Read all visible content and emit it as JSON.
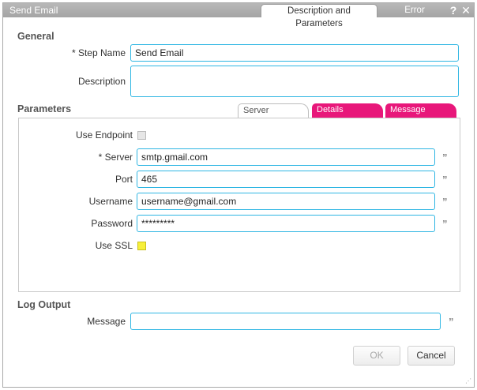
{
  "window": {
    "title": "Send Email",
    "tabs": [
      {
        "label": "Description and Parameters",
        "active": true
      },
      {
        "label": "Error Handling",
        "active": false
      }
    ],
    "help_icon": "?",
    "close_icon": "✕"
  },
  "general": {
    "section_label": "General",
    "step_name_label": "* Step Name",
    "step_name_value": "Send Email",
    "description_label": "Description",
    "description_value": ""
  },
  "parameters": {
    "section_label": "Parameters",
    "tabs": [
      {
        "label": "Server",
        "active": true,
        "color": "#ffffff"
      },
      {
        "label": "Details",
        "active": false,
        "color": "#e8177a"
      },
      {
        "label": "Message",
        "active": false,
        "color": "#e8177a"
      }
    ],
    "use_endpoint_label": "Use Endpoint",
    "use_endpoint_checked": false,
    "server_label": "* Server",
    "server_value": "smtp.gmail.com",
    "port_label": "Port",
    "port_value": "465",
    "username_label": "Username",
    "username_value": "username@gmail.com",
    "password_label": "Password",
    "password_value": "*********",
    "use_ssl_label": "Use SSL",
    "use_ssl_color": "#f7f03a",
    "expression_glyph": "”"
  },
  "log_output": {
    "section_label": "Log Output",
    "message_label": "Message",
    "message_value": ""
  },
  "buttons": {
    "ok_label": "OK",
    "cancel_label": "Cancel"
  },
  "colors": {
    "accent_border": "#2fb6e3",
    "tab_pink": "#e8177a",
    "titlebar": "#a9a9a9"
  }
}
